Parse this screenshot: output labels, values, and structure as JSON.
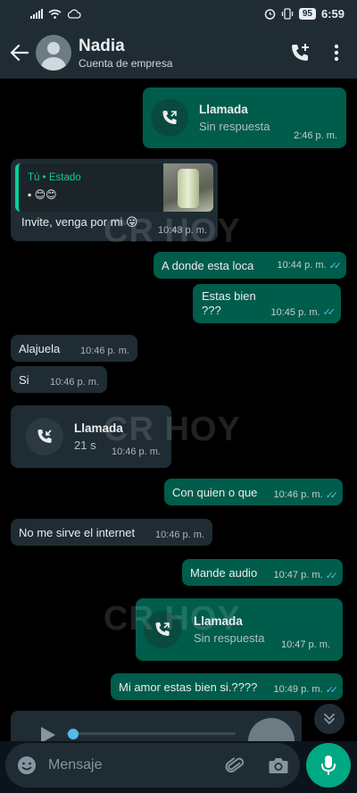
{
  "status_bar": {
    "battery": "95",
    "clock": "6:59"
  },
  "header": {
    "contact_name": "Nadia",
    "subtitle": "Cuenta de empresa"
  },
  "watermark": "CR HOY",
  "messages": [
    {
      "kind": "call",
      "direction": "outgoing",
      "title": "Llamada",
      "status": "Sin respuesta",
      "time": "2:46 p. m."
    },
    {
      "kind": "reply",
      "direction": "incoming",
      "quote_author": "Tú • Estado",
      "quote_emoji": "▪ 😊😊",
      "text": "Invite, venga por mi 😛",
      "time": "10:43 p. m."
    },
    {
      "kind": "text",
      "direction": "outgoing",
      "text": "A donde esta loca",
      "time": "10:44 p. m.",
      "read": true
    },
    {
      "kind": "text",
      "direction": "outgoing",
      "text": "Estas bien",
      "text2": "???",
      "time": "10:45 p. m.",
      "read": true
    },
    {
      "kind": "text",
      "direction": "incoming",
      "text": "Alajuela",
      "time": "10:46 p. m."
    },
    {
      "kind": "text",
      "direction": "incoming",
      "text": "Si",
      "time": "10:46 p. m."
    },
    {
      "kind": "call",
      "direction": "incoming",
      "title": "Llamada",
      "status": "21 s",
      "time": "10:46 p. m."
    },
    {
      "kind": "text",
      "direction": "outgoing",
      "text": "Con quien o que",
      "time": "10:46 p. m.",
      "read": true
    },
    {
      "kind": "text",
      "direction": "incoming",
      "text": "No me sirve el internet",
      "time": "10:46 p. m."
    },
    {
      "kind": "text",
      "direction": "outgoing",
      "text": "Mande audio",
      "time": "10:47 p. m.",
      "read": true
    },
    {
      "kind": "call",
      "direction": "outgoing",
      "title": "Llamada",
      "status": "Sin respuesta",
      "time": "10:47 p. m."
    },
    {
      "kind": "text",
      "direction": "outgoing",
      "text": "Mi amor estas bien si.????",
      "time": "10:49 p. m.",
      "read": true
    }
  ],
  "composer": {
    "placeholder": "Mensaje"
  },
  "icons": {
    "back": "arrow-left-icon",
    "add_call": "add-call-icon",
    "menu": "more-vert-icon",
    "outgoing_call": "outgoing-call-icon",
    "incoming_call": "incoming-call-icon",
    "emoji": "emoji-icon",
    "attach": "paperclip-icon",
    "camera": "camera-icon",
    "mic": "mic-icon",
    "scroll_down": "double-chevron-down-icon"
  },
  "colors": {
    "outgoing_bubble": "#005c4b",
    "incoming_bubble": "#1f2c34",
    "accent": "#00a884",
    "read_ticks": "#53bdeb"
  }
}
